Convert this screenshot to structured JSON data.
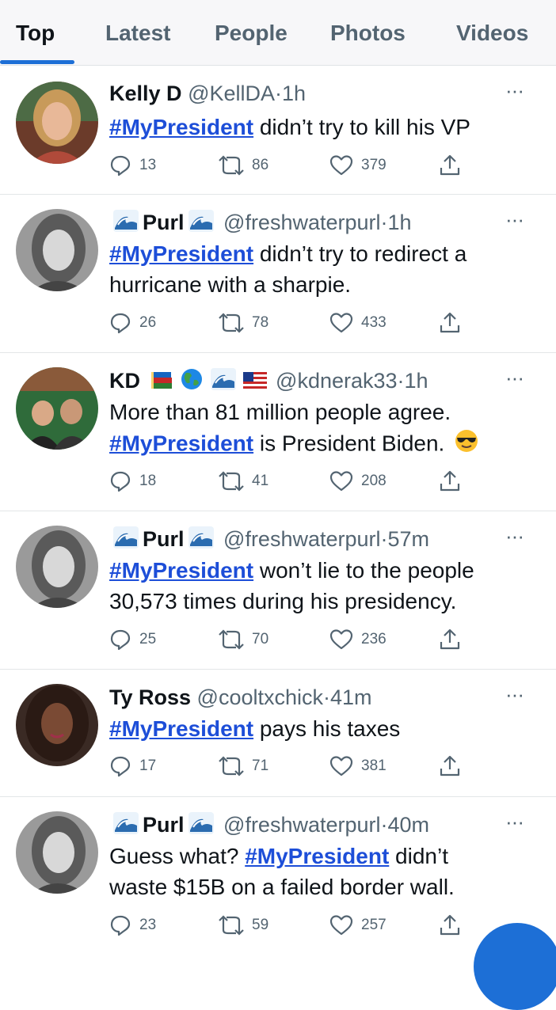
{
  "tabs": [
    {
      "label": "Top",
      "active": true
    },
    {
      "label": "Latest",
      "active": false
    },
    {
      "label": "People",
      "active": false
    },
    {
      "label": "Photos",
      "active": false
    },
    {
      "label": "Videos",
      "active": false
    }
  ],
  "tweets": [
    {
      "name": "Kelly D",
      "handle": "@KellDA",
      "sep": "·",
      "time": "1h",
      "line1_tag": "#MyPresident",
      "line1_rest": " didn’t try to kill his VP",
      "replies": "13",
      "retweets": "86",
      "likes": "379"
    },
    {
      "name": "Purl",
      "handle": "@freshwaterpurl",
      "sep": "·",
      "time": "1h",
      "line1_tag": "#MyPresident",
      "line1_rest": " didn’t try to redirect a",
      "line2": "hurricane with a sharpie.",
      "replies": "26",
      "retweets": "78",
      "likes": "433"
    },
    {
      "name": "KD",
      "handle": "@kdnerak33",
      "sep": "·",
      "time": "1h",
      "line1": "More than 81 million people agree.",
      "line2_tag": "#MyPresident",
      "line2_rest": " is President Biden. ",
      "replies": "18",
      "retweets": "41",
      "likes": "208"
    },
    {
      "name": "Purl",
      "handle": "@freshwaterpurl",
      "sep": "·",
      "time": "57m",
      "line1_tag": "#MyPresident",
      "line1_rest": " won’t lie to the people",
      "line2": "30,573 times during his presidency.",
      "replies": "25",
      "retweets": "70",
      "likes": "236"
    },
    {
      "name": "Ty Ross",
      "handle": "@cooltxchick",
      "sep": "·",
      "time": "41m",
      "line1_tag": "#MyPresident",
      "line1_rest": " pays his taxes",
      "replies": "17",
      "retweets": "71",
      "likes": "381"
    },
    {
      "name": "Purl",
      "handle": "@freshwaterpurl",
      "sep": "·",
      "time": "40m",
      "line1_pre": "Guess what? ",
      "line1_tag": "#MyPresident",
      "line1_rest": " didn’t",
      "line2": "waste $15B on a failed border wall.",
      "replies": "23",
      "retweets": "59",
      "likes": "257"
    }
  ],
  "more_glyph": "···",
  "colors": {
    "link": "#1d4ed8",
    "accent": "#1d6fd6",
    "muted": "#536471"
  }
}
